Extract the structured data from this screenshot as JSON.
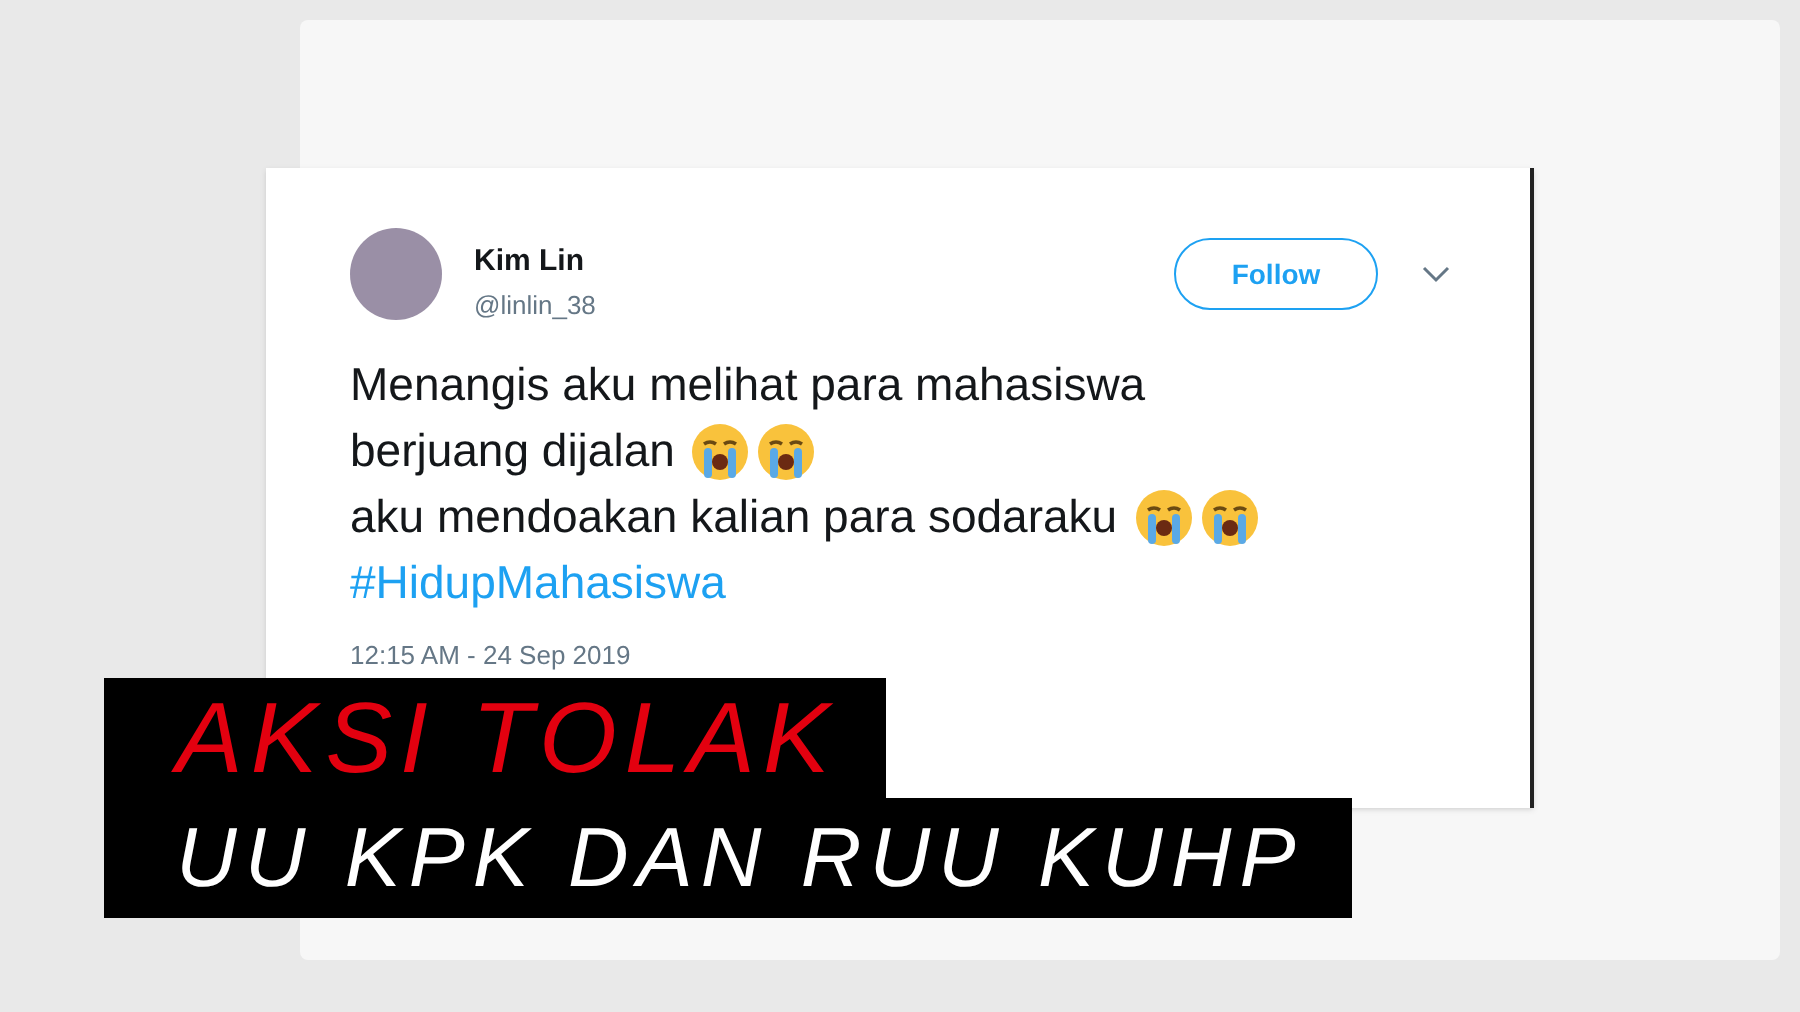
{
  "tweet": {
    "name": "Kim Lin",
    "handle": "@linlin_38",
    "follow_button": "Follow",
    "lines": [
      {
        "text": "Menangis aku melihat para mahasiswa",
        "kind": "plain"
      },
      {
        "text": "berjuang dijalan",
        "kind": "emoji"
      },
      {
        "text": "aku mendoakan kalian para sodaraku",
        "kind": "emoji"
      },
      {
        "text": "#HidupMahasiswa",
        "kind": "hashtag"
      }
    ],
    "timestamp": "12:15 AM - 24 Sep 2019"
  },
  "caption": {
    "line_1": "AKSI TOLAK",
    "line_2": "UU KPK DAN RUU KUHP"
  }
}
